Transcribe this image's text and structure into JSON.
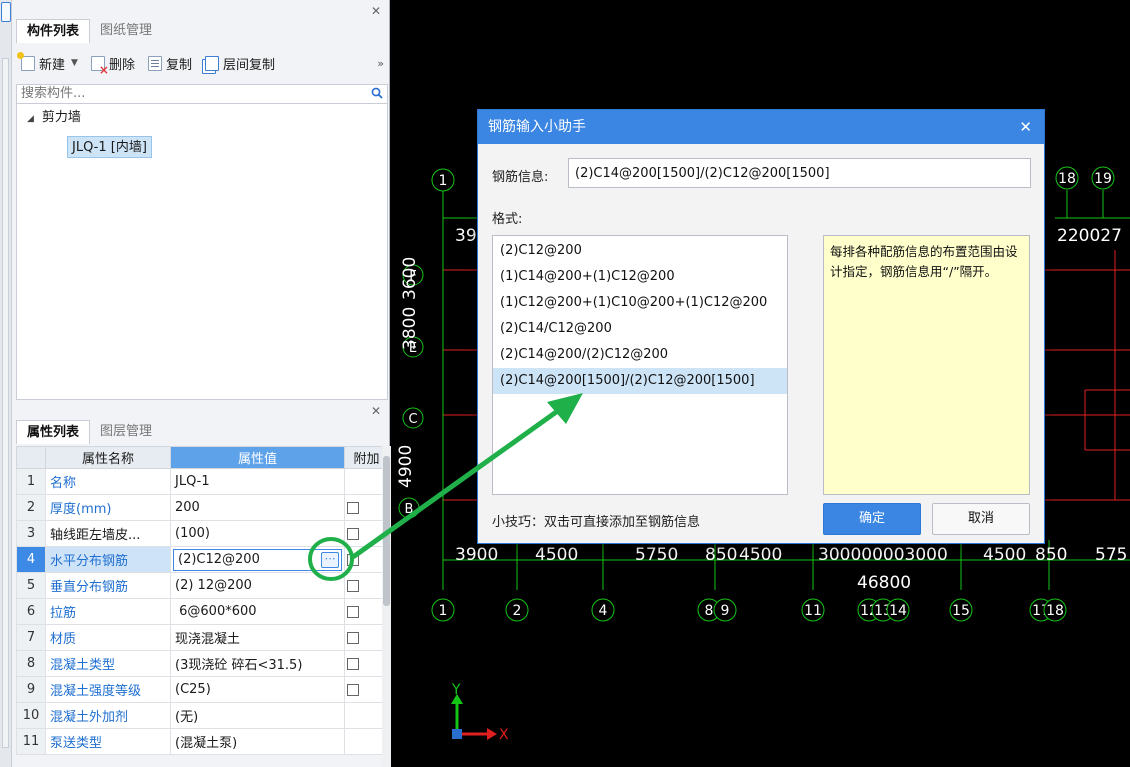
{
  "component_panel": {
    "tabs": [
      {
        "label": "构件列表"
      },
      {
        "label": "图纸管理"
      }
    ],
    "toolbar": {
      "new_label": "新建",
      "delete_label": "删除",
      "copy_label": "复制",
      "floor_copy_label": "层间复制"
    },
    "search_placeholder": "搜索构件...",
    "tree": {
      "group_label": "剪力墙",
      "item_label": "JLQ-1 [内墙]"
    }
  },
  "property_panel": {
    "tabs": [
      {
        "label": "属性列表"
      },
      {
        "label": "图层管理"
      }
    ],
    "headers": {
      "name": "属性名称",
      "value": "属性值",
      "extra": "附加"
    },
    "rows": [
      {
        "index": "1",
        "name": "名称",
        "value": "JLQ-1"
      },
      {
        "index": "2",
        "name": "厚度(mm)",
        "value": "200"
      },
      {
        "index": "3",
        "name": "轴线距左墙皮...",
        "value": "(100)"
      },
      {
        "index": "4",
        "name": "水平分布钢筋",
        "value": "(2)C12@200"
      },
      {
        "index": "5",
        "name": "垂直分布钢筋",
        "value": "(2) 12@200"
      },
      {
        "index": "6",
        "name": "拉筋",
        "value": " 6@600*600"
      },
      {
        "index": "7",
        "name": "材质",
        "value": "现浇混凝土"
      },
      {
        "index": "8",
        "name": "混凝土类型",
        "value": "(3现浇砼 碎石<31.5)"
      },
      {
        "index": "9",
        "name": "混凝土强度等级",
        "value": "(C25)"
      },
      {
        "index": "10",
        "name": "混凝土外加剂",
        "value": "(无)"
      },
      {
        "index": "11",
        "name": "泵送类型",
        "value": "(混凝土泵)"
      }
    ]
  },
  "dialog": {
    "title": "钢筋输入小助手",
    "info_label": "钢筋信息:",
    "info_value": "(2)C14@200[1500]/(2)C12@200[1500]",
    "format_label": "格式:",
    "formats": [
      "(2)C12@200",
      "(1)C14@200+(1)C12@200",
      "(1)C12@200+(1)C10@200+(1)C12@200",
      "(2)C14/C12@200",
      "(2)C14@200/(2)C12@200",
      "(2)C14@200[1500]/(2)C12@200[1500]"
    ],
    "tip_text": "每排各种配筋信息的布置范围由设计指定，钢筋信息用“/”隔开。",
    "hint": "小技巧：双击可直接添加至钢筋信息",
    "ok_label": "确定",
    "cancel_label": "取消"
  },
  "cad": {
    "axis_top": [
      "1",
      "18",
      "19"
    ],
    "axis_left": [
      "F",
      "E",
      "C",
      "B"
    ],
    "axis_bottom": [
      "1",
      "2",
      "4",
      "8",
      "9",
      "11",
      "12",
      "13",
      "14",
      "15",
      "17",
      "18"
    ],
    "dims_top": [
      "39",
      "220027"
    ],
    "dims_left": [
      "3800",
      "3600",
      "4900"
    ],
    "dims_bottom": [
      "3900",
      "4500",
      "5750",
      "850",
      "4500",
      "300000003000",
      "4500",
      "850",
      "575"
    ],
    "dim_46800": "46800",
    "ucs_y": "Y",
    "ucs_x": "X"
  },
  "colors": {
    "accent": "#3b86e3",
    "link_blue": "#1f6fd1",
    "annotation_green": "#1fb04a",
    "cad_green": "#15c515",
    "cad_red": "#e02020"
  }
}
